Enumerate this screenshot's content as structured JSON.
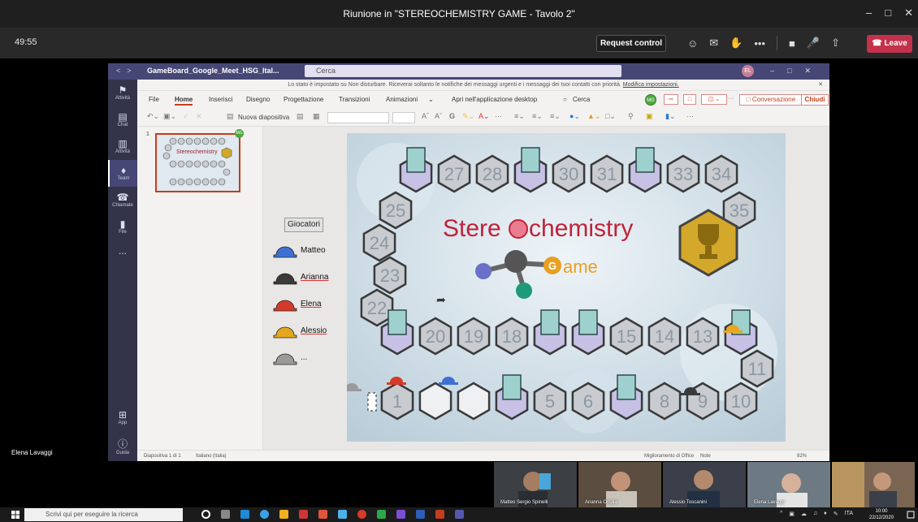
{
  "meeting": {
    "title": "Riunione in \"STEREOCHEMISTRY GAME - Tavolo 2\"",
    "timer": "49:55",
    "request_control": "Request control",
    "leave": "Leave"
  },
  "teams": {
    "file_name": "GameBoard_Google_Meet_HSG_Ital...",
    "search_placeholder": "Cerca",
    "avatar": "EL",
    "notification": "Lo stato è impostato su Non disturbare. Riceverai soltanto le notifiche dei messaggi urgenti e i messaggi dei tuoi contatti con priorità.",
    "notification_link": "Modifica impostazioni.",
    "rail": [
      {
        "icon": "bell-icon",
        "label": "Attività"
      },
      {
        "icon": "chat-icon",
        "label": "Chat"
      },
      {
        "icon": "activity-icon",
        "label": "Attività"
      },
      {
        "icon": "teams-icon",
        "label": "Team"
      },
      {
        "icon": "phone-icon",
        "label": "Chiamate"
      },
      {
        "icon": "file-icon",
        "label": "File"
      },
      {
        "icon": "more-icon",
        "label": "..."
      }
    ],
    "rail_bottom": [
      {
        "icon": "apps-icon",
        "label": "App"
      },
      {
        "icon": "help-icon",
        "label": "Guida"
      }
    ]
  },
  "ribbon": {
    "tabs": [
      "File",
      "Home",
      "Inserisci",
      "Disegno",
      "Progettazione",
      "Transizioni",
      "Animazioni"
    ],
    "open_desktop": "Apri nell'applicazione desktop",
    "search": "Cerca",
    "badge": "MG",
    "conversation": "Conversazione",
    "close": "Chiudi",
    "new_slide": "Nuova diapositiva"
  },
  "slides": {
    "number": "1",
    "thumb_title": "Stereochemistry"
  },
  "board": {
    "title_left": "Stere",
    "title_right": "chemistry",
    "subtitle": "ame",
    "top_row": [
      "27",
      "28",
      "30",
      "31",
      "33",
      "34"
    ],
    "right_top": "35",
    "left_col": [
      "25",
      "24",
      "23",
      "22"
    ],
    "mid_row": [
      "20",
      "19",
      "18",
      "15",
      "14",
      "13"
    ],
    "right_mid": "11",
    "bottom_row": [
      "1",
      "5",
      "6",
      "8",
      "9",
      "10"
    ],
    "players_header": "Giocatori",
    "players": [
      {
        "name": "Matteo",
        "color": "#3f6fd3"
      },
      {
        "name": "Arianna",
        "color": "#3a3a3a"
      },
      {
        "name": "Elena",
        "color": "#d43a2a"
      },
      {
        "name": "Alessio",
        "color": "#e6a720"
      },
      {
        "name": "...",
        "color": "#9a9a9a"
      }
    ]
  },
  "status": {
    "slide": "Diapositiva 1 di 1",
    "lang": "Italiano (Italia)",
    "improve": "Miglioramento di Office",
    "notes": "Note",
    "zoom": "92%"
  },
  "presenter": "Elena Lavaggi",
  "participants": [
    {
      "name": "Matteo Sergio Spinelli",
      "bg": "#3c3f44"
    },
    {
      "name": "Arianna Origlia",
      "bg": "#5b4d3f"
    },
    {
      "name": "Alessio Toscanini",
      "bg": "#3a3f4a"
    },
    {
      "name": "Elena Lavaggi",
      "bg": "#6d7a84"
    },
    {
      "name": "",
      "bg": "#7a6552"
    }
  ],
  "taskbar": {
    "search_placeholder": "Scrivi qui per eseguire la ricerca",
    "lang": "ITA",
    "time": "10:00",
    "date": "22/12/2020"
  }
}
